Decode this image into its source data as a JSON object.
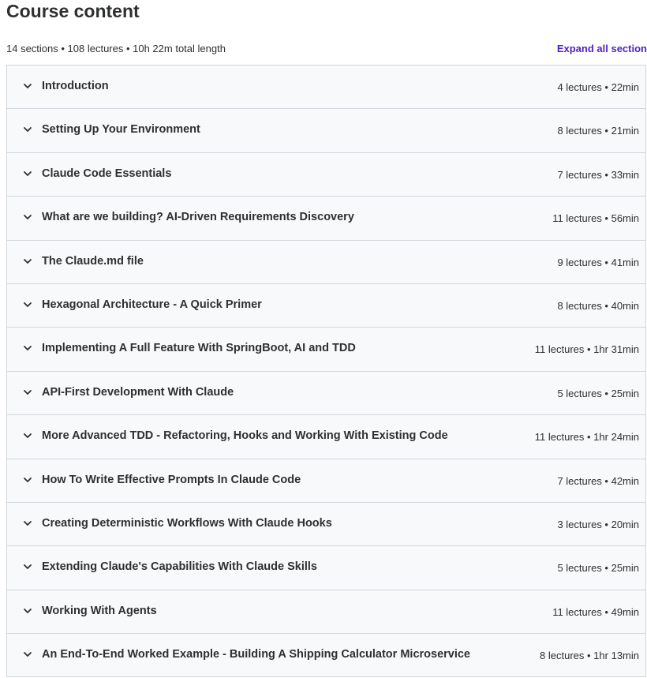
{
  "header": {
    "title": "Course content",
    "summary": "14 sections • 108 lectures • 10h 22m total length",
    "expand_all": "Expand all section"
  },
  "colors": {
    "accent": "#5022c3",
    "section_bg": "#f7f9fa",
    "border": "#d1d7dc",
    "text": "#2d2f31"
  },
  "sections": [
    {
      "title": "Introduction",
      "meta": "4 lectures • 22min",
      "icon": "chevron-down-icon"
    },
    {
      "title": "Setting Up Your Environment",
      "meta": "8 lectures • 21min",
      "icon": "chevron-down-icon"
    },
    {
      "title": "Claude Code Essentials",
      "meta": "7 lectures • 33min",
      "icon": "chevron-down-icon"
    },
    {
      "title": "What are we building? AI-Driven Requirements Discovery",
      "meta": "11 lectures • 56min",
      "icon": "chevron-down-icon"
    },
    {
      "title": "The Claude.md file",
      "meta": "9 lectures • 41min",
      "icon": "chevron-down-icon"
    },
    {
      "title": "Hexagonal Architecture - A Quick Primer",
      "meta": "8 lectures • 40min",
      "icon": "chevron-down-icon"
    },
    {
      "title": "Implementing A Full Feature With SpringBoot, AI and TDD",
      "meta": "11 lectures • 1hr 31min",
      "icon": "chevron-down-icon"
    },
    {
      "title": "API-First Development With Claude",
      "meta": "5 lectures • 25min",
      "icon": "chevron-down-icon"
    },
    {
      "title": "More Advanced TDD - Refactoring, Hooks and Working With Existing Code",
      "meta": "11 lectures • 1hr 24min",
      "icon": "chevron-down-icon"
    },
    {
      "title": "How To Write Effective Prompts In Claude Code",
      "meta": "7 lectures • 42min",
      "icon": "chevron-down-icon"
    },
    {
      "title": "Creating Deterministic Workflows With Claude Hooks",
      "meta": "3 lectures • 20min",
      "icon": "chevron-down-icon"
    },
    {
      "title": "Extending Claude's Capabilities With Claude Skills",
      "meta": "5 lectures • 25min",
      "icon": "chevron-down-icon"
    },
    {
      "title": "Working With Agents",
      "meta": "11 lectures • 49min",
      "icon": "chevron-down-icon"
    },
    {
      "title": "An End-To-End Worked Example - Building A Shipping Calculator Microservice",
      "meta": "8 lectures • 1hr 13min",
      "icon": "chevron-down-icon"
    }
  ]
}
